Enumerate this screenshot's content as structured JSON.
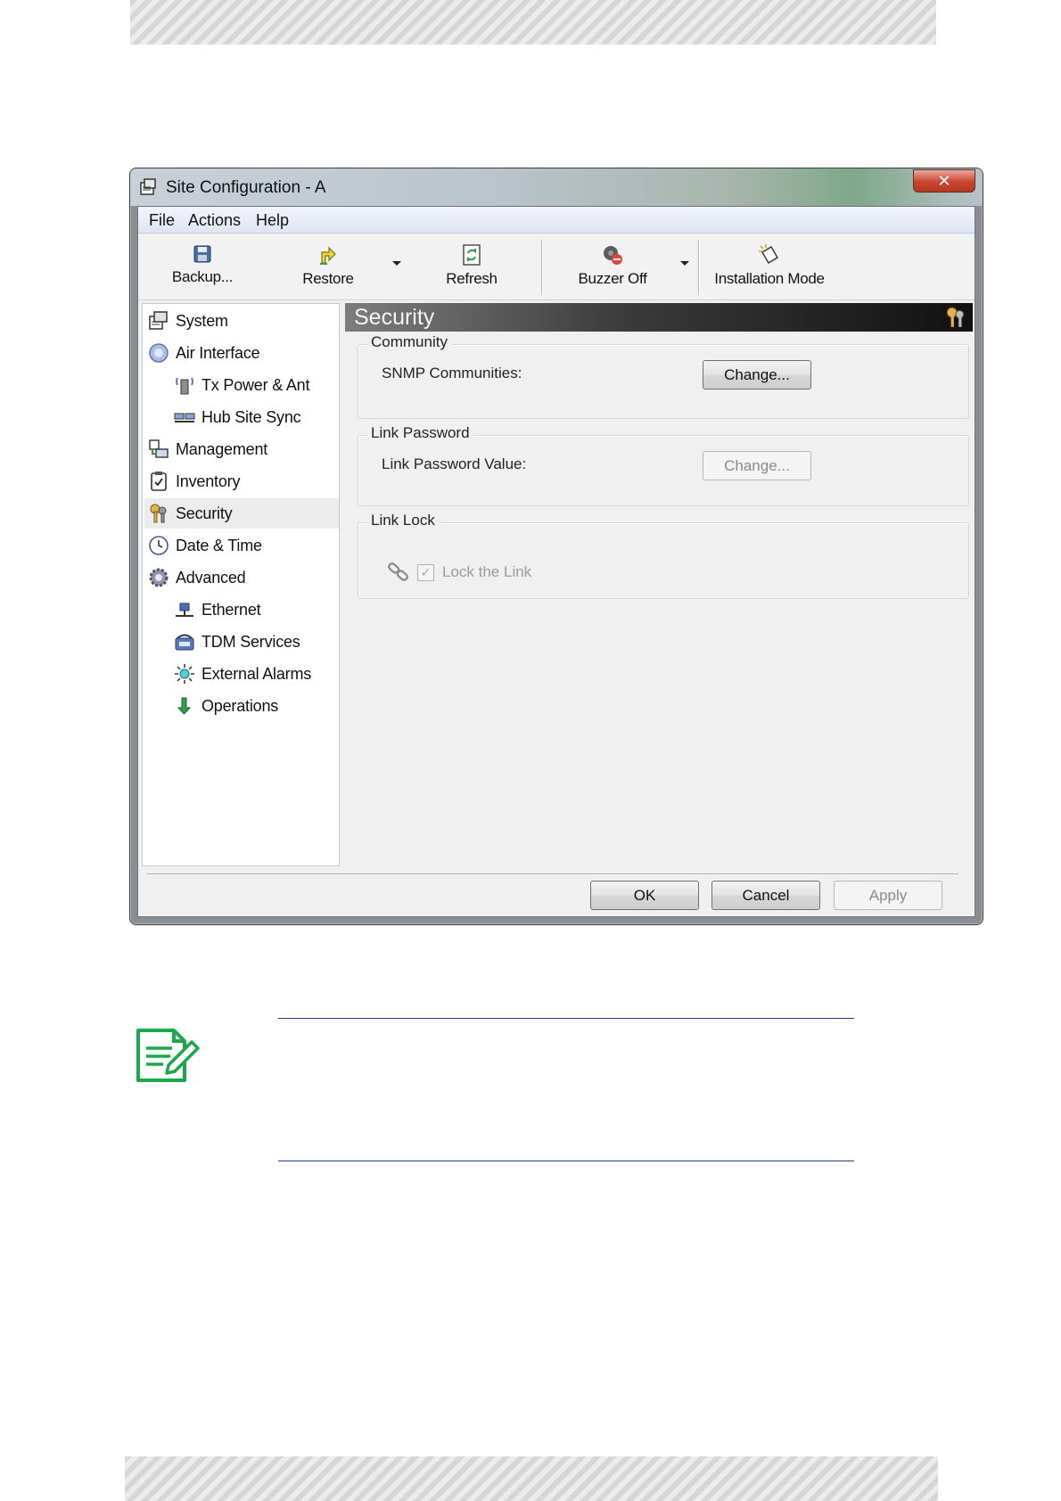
{
  "window": {
    "title": "Site Configuration - A",
    "close_label": "✕"
  },
  "menu": [
    "File",
    "Actions",
    "Help"
  ],
  "toolbar": {
    "backup": "Backup...",
    "restore": "Restore",
    "refresh": "Refresh",
    "buzzer_off": "Buzzer Off",
    "installation_mode": "Installation Mode"
  },
  "tree": {
    "items": [
      {
        "label": "System",
        "icon": "system-icon"
      },
      {
        "label": "Air Interface",
        "icon": "air-interface-icon"
      },
      {
        "label": "Tx Power & Ant",
        "icon": "tx-power-icon"
      },
      {
        "label": "Hub Site Sync",
        "icon": "hub-site-sync-icon"
      },
      {
        "label": "Management",
        "icon": "management-icon"
      },
      {
        "label": "Inventory",
        "icon": "inventory-icon"
      },
      {
        "label": "Security",
        "icon": "security-icon",
        "selected": true
      },
      {
        "label": "Date & Time",
        "icon": "clock-icon"
      },
      {
        "label": "Advanced",
        "icon": "gear-icon"
      },
      {
        "label": "Ethernet",
        "icon": "ethernet-icon"
      },
      {
        "label": "TDM Services",
        "icon": "tdm-services-icon"
      },
      {
        "label": "External Alarms",
        "icon": "external-alarms-icon"
      },
      {
        "label": "Operations",
        "icon": "operations-icon"
      }
    ]
  },
  "panel": {
    "title": "Security",
    "community": {
      "legend": "Community",
      "label": "SNMP Communities:",
      "button": "Change..."
    },
    "link_password": {
      "legend": "Link Password",
      "label": "Link Password Value:",
      "button": "Change..."
    },
    "link_lock": {
      "legend": "Link Lock",
      "checkbox_label": "Lock the Link",
      "checked": true
    }
  },
  "dialog_buttons": {
    "ok": "OK",
    "cancel": "Cancel",
    "apply": "Apply"
  },
  "colors": {
    "note_icon": "#1aa84a",
    "note_rule": "#2a3b8f"
  }
}
